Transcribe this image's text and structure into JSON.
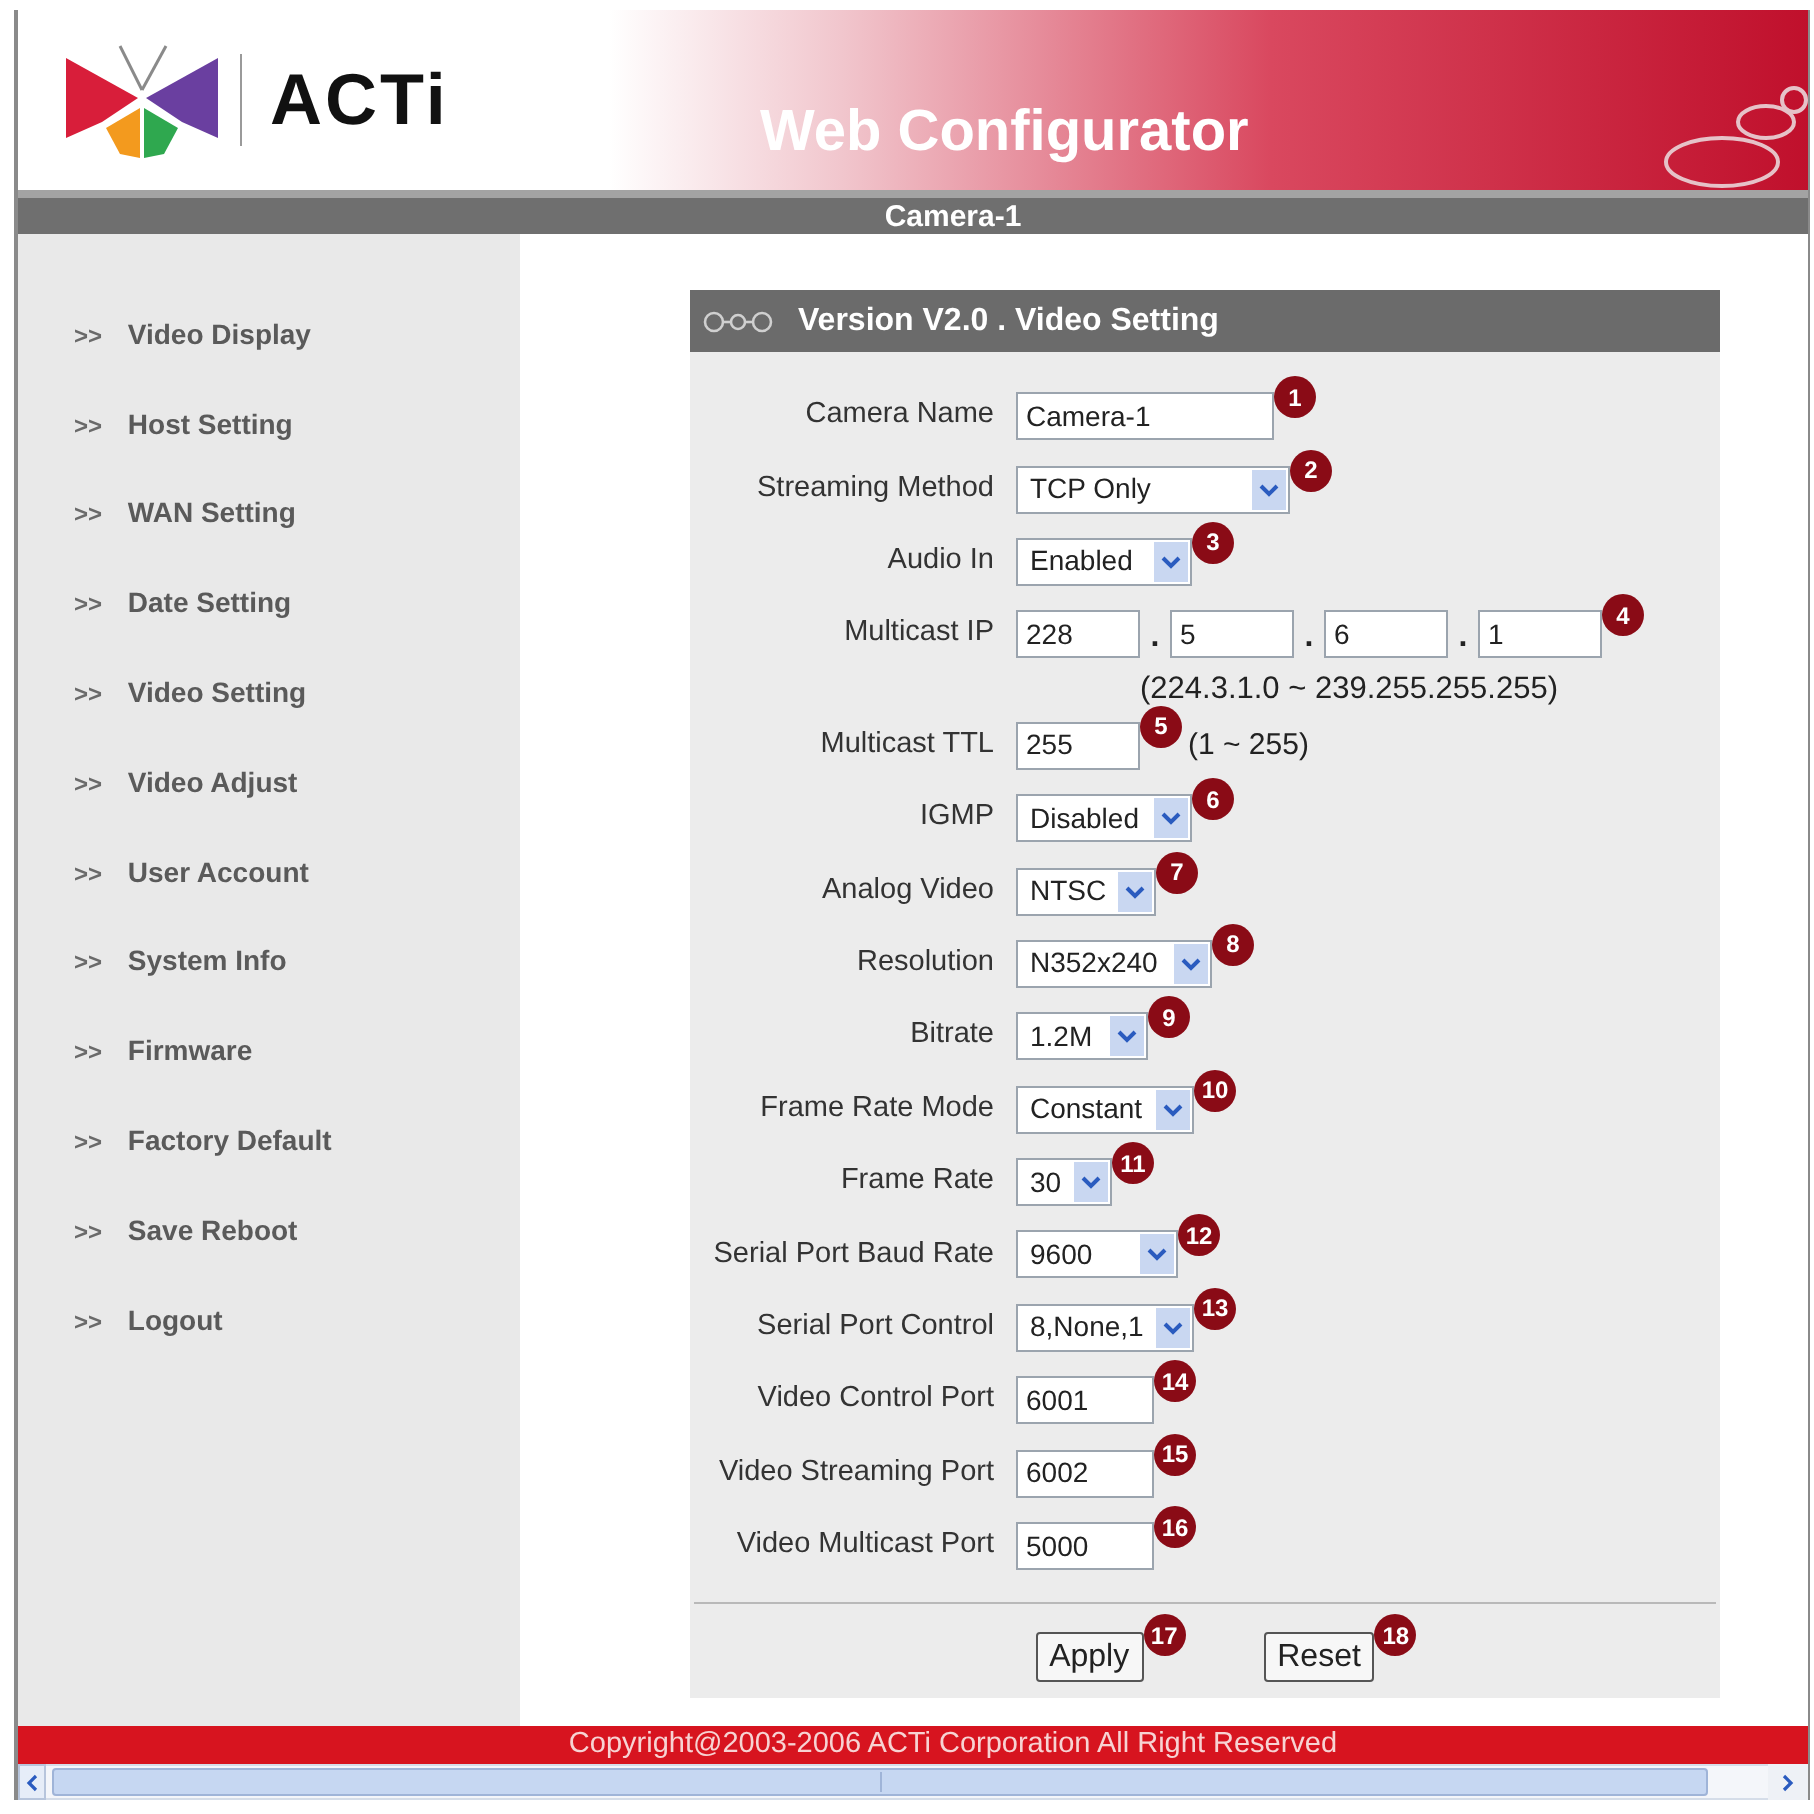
{
  "header": {
    "logo_text": "ACTi",
    "title": "Web Configurator"
  },
  "camera_bar": {
    "label": "Camera-1"
  },
  "sidebar": {
    "items": [
      {
        "prefix": ">>",
        "label": "Video Display"
      },
      {
        "prefix": ">>",
        "label": "Host Setting"
      },
      {
        "prefix": ">>",
        "label": "WAN Setting"
      },
      {
        "prefix": ">>",
        "label": "Date Setting"
      },
      {
        "prefix": ">>",
        "label": "Video Setting"
      },
      {
        "prefix": ">>",
        "label": "Video Adjust"
      },
      {
        "prefix": ">>",
        "label": "User Account"
      },
      {
        "prefix": ">>",
        "label": "System Info"
      },
      {
        "prefix": ">>",
        "label": "Firmware"
      },
      {
        "prefix": ">>",
        "label": "Factory Default"
      },
      {
        "prefix": ">>",
        "label": "Save Reboot"
      },
      {
        "prefix": ">>",
        "label": "Logout"
      }
    ]
  },
  "panel": {
    "title": "Version V2.0 . Video Setting",
    "fields": [
      {
        "kind": "text",
        "label": "Camera Name",
        "value": "Camera-1",
        "callout": "1"
      },
      {
        "kind": "select",
        "label": "Streaming Method",
        "value": "TCP Only",
        "callout": "2"
      },
      {
        "kind": "select",
        "label": "Audio In",
        "value": "Enabled",
        "callout": "3"
      },
      {
        "kind": "ip",
        "label": "Multicast IP",
        "parts": [
          "228",
          "5",
          "6",
          "1"
        ],
        "separators": [
          ".",
          ".",
          "."
        ],
        "callout": "4",
        "hint": "(224.3.1.0 ~ 239.255.255.255)"
      },
      {
        "kind": "text",
        "label": "Multicast TTL",
        "value": "255",
        "callout": "5",
        "note": "(1 ~ 255)"
      },
      {
        "kind": "select",
        "label": "IGMP",
        "value": "Disabled",
        "callout": "6"
      },
      {
        "kind": "select",
        "label": "Analog Video",
        "value": "NTSC",
        "callout": "7"
      },
      {
        "kind": "select",
        "label": "Resolution",
        "value": "N352x240",
        "callout": "8"
      },
      {
        "kind": "select",
        "label": "Bitrate",
        "value": "1.2M",
        "callout": "9"
      },
      {
        "kind": "select",
        "label": "Frame Rate Mode",
        "value": "Constant",
        "callout": "10"
      },
      {
        "kind": "select",
        "label": "Frame Rate",
        "value": "30",
        "callout": "11"
      },
      {
        "kind": "select",
        "label": "Serial Port Baud Rate",
        "value": "9600",
        "callout": "12"
      },
      {
        "kind": "select",
        "label": "Serial Port Control",
        "value": "8,None,1",
        "callout": "13"
      },
      {
        "kind": "text",
        "label": "Video Control Port",
        "value": "6001",
        "callout": "14"
      },
      {
        "kind": "text",
        "label": "Video Streaming Port",
        "value": "6002",
        "callout": "15"
      },
      {
        "kind": "text",
        "label": "Video Multicast Port",
        "value": "5000",
        "callout": "16"
      }
    ],
    "buttons": [
      {
        "label": "Apply",
        "callout": "17"
      },
      {
        "label": "Reset",
        "callout": "18"
      }
    ]
  },
  "footer": {
    "copyright": "Copyright@2003-2006 ACTi Corporation All Right Reserved"
  }
}
